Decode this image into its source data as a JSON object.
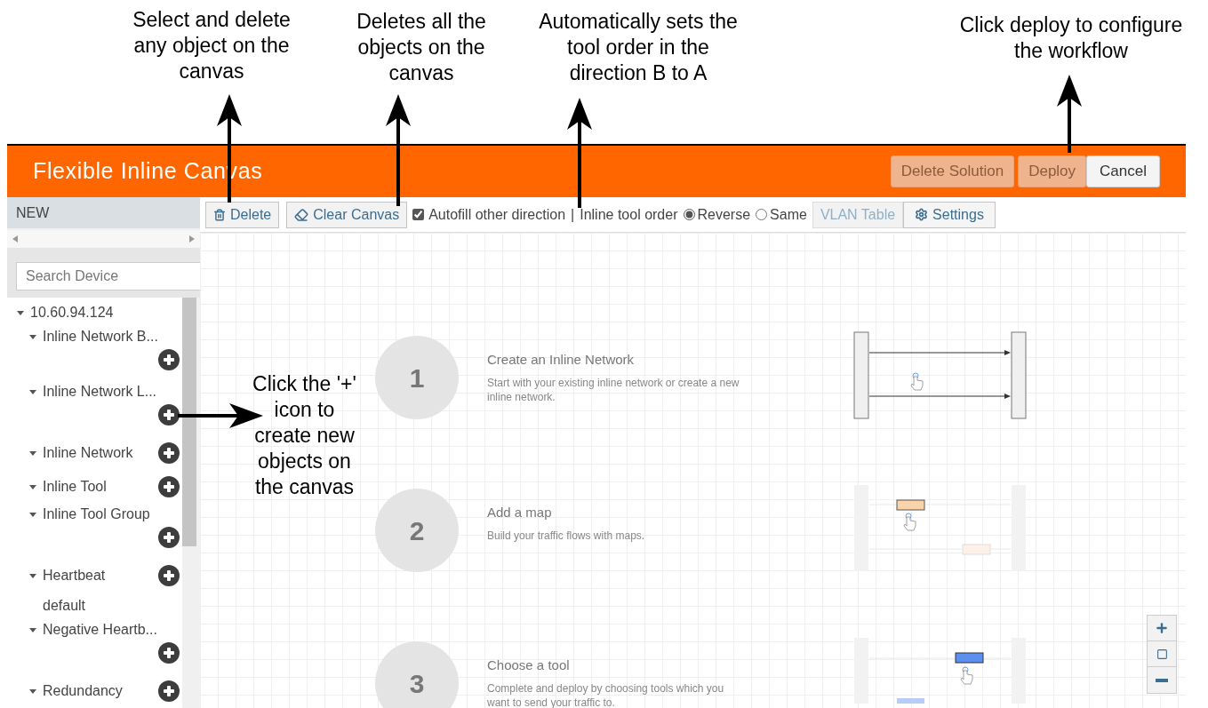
{
  "callouts": [
    {
      "text": "Select and delete any object on the canvas"
    },
    {
      "text": "Deletes all the objects on the canvas"
    },
    {
      "text": "Automatically sets the tool order in the direction B to A"
    },
    {
      "text": "Click deploy to configure the workflow"
    },
    {
      "text": "Click the '+' icon to create new objects on the canvas"
    }
  ],
  "header": {
    "title": "Flexible Inline Canvas",
    "buttons": [
      {
        "label": "Delete Solution",
        "disabled": true
      },
      {
        "label": "Deploy",
        "disabled": true
      },
      {
        "label": "Cancel",
        "disabled": false
      }
    ]
  },
  "sidebar": {
    "heading": "NEW",
    "search": {
      "placeholder": "Search Device"
    },
    "tree": [
      {
        "label": "10.60.94.124",
        "expanded": true,
        "children": [
          {
            "label": "Inline Network B...",
            "expanded": true,
            "kind": "stacked"
          },
          {
            "label": "Inline Network L...",
            "expanded": true,
            "kind": "stacked"
          },
          {
            "label": "Inline Network",
            "expanded": true,
            "kind": "inline"
          },
          {
            "label": "Inline Tool",
            "expanded": true,
            "kind": "inline"
          },
          {
            "label": "Inline Tool Group",
            "expanded": true,
            "kind": "stacked"
          },
          {
            "label": "Heartbeat",
            "expanded": true,
            "kind": "inline",
            "children": [
              {
                "label": "default"
              }
            ]
          },
          {
            "label": "Negative Heartb...",
            "expanded": true,
            "kind": "stacked"
          },
          {
            "label": "Redundancy",
            "expanded": true,
            "kind": "inline"
          }
        ]
      }
    ]
  },
  "toolbar": {
    "delete_button": "Delete",
    "clear_button": "Clear Canvas",
    "autofill": {
      "label": "Autofill other direction",
      "checked": true
    },
    "separator": "|",
    "tool_order": {
      "label": "Inline tool order",
      "options": [
        {
          "label": "Reverse",
          "selected": true
        },
        {
          "label": "Same",
          "selected": false
        }
      ]
    },
    "vlan_button": {
      "label": "VLAN Table",
      "disabled": true
    },
    "settings_button": {
      "label": "Settings",
      "disabled": false
    }
  },
  "steps": [
    {
      "number": "1",
      "title": "Create an Inline Network",
      "description": "Start with your existing inline network or create a new inline network."
    },
    {
      "number": "2",
      "title": "Add a map",
      "description": "Build your traffic flows with maps."
    },
    {
      "number": "3",
      "title": "Choose a tool",
      "description": "Complete and deploy by choosing tools which you want to send your traffic to."
    }
  ]
}
